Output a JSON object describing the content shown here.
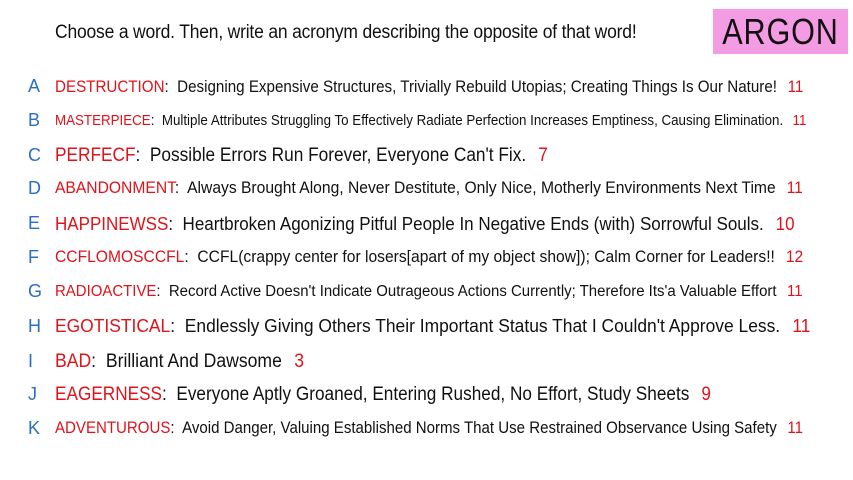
{
  "prompt": "Choose a word. Then, write an acronym describing the opposite of that word!",
  "badge": "ARGON",
  "rows": [
    {
      "letter": "A",
      "word": "DESTRUCTION",
      "acronym": "Designing Expensive Structures, Trivially Rebuild Utopias; Creating Things Is Our Nature!",
      "count": "11"
    },
    {
      "letter": "B",
      "word": "MASTERPIECE",
      "acronym": "Multiple Attributes Struggling To Effectively Radiate Perfection Increases Emptiness, Causing Elimination.",
      "count": "11"
    },
    {
      "letter": "C",
      "word": "PERFECF",
      "acronym": "Possible Errors Run Forever, Everyone Can't Fix.",
      "count": "7"
    },
    {
      "letter": "D",
      "word": "ABANDONMENT",
      "acronym": "Always Brought Along, Never Destitute, Only Nice, Motherly Environments Next Time",
      "count": "11"
    },
    {
      "letter": "E",
      "word": "HAPPINEWSS",
      "acronym": "Heartbroken Agonizing Pitful People In Negative Ends (with) Sorrowful Souls.",
      "count": "10"
    },
    {
      "letter": "F",
      "word": "CCFLOMOSCCFL",
      "acronym": "CCFL(crappy center for losers[apart of my object show]); Calm Corner for Leaders!!",
      "count": "12"
    },
    {
      "letter": "G",
      "word": "RADIOACTIVE",
      "acronym": "Record Active Doesn't Indicate Outrageous Actions Currently; Therefore Its'a Valuable Effort",
      "count": "11"
    },
    {
      "letter": "H",
      "word": "EGOTISTICAL",
      "acronym": "Endlessly Giving Others Their Important Status That I Couldn't Approve Less.",
      "count": "11"
    },
    {
      "letter": "I",
      "word": "BAD",
      "acronym": "Brilliant And Dawsome",
      "count": "3"
    },
    {
      "letter": "J",
      "word": "EAGERNESS",
      "acronym": "Everyone Aptly Groaned, Entering Rushed, No Effort, Study Sheets",
      "count": "9"
    },
    {
      "letter": "K",
      "word": "ADVENTUROUS",
      "acronym": "Avoid Danger, Valuing Established Norms That Use Restrained Observance Using Safety",
      "count": "11"
    }
  ]
}
